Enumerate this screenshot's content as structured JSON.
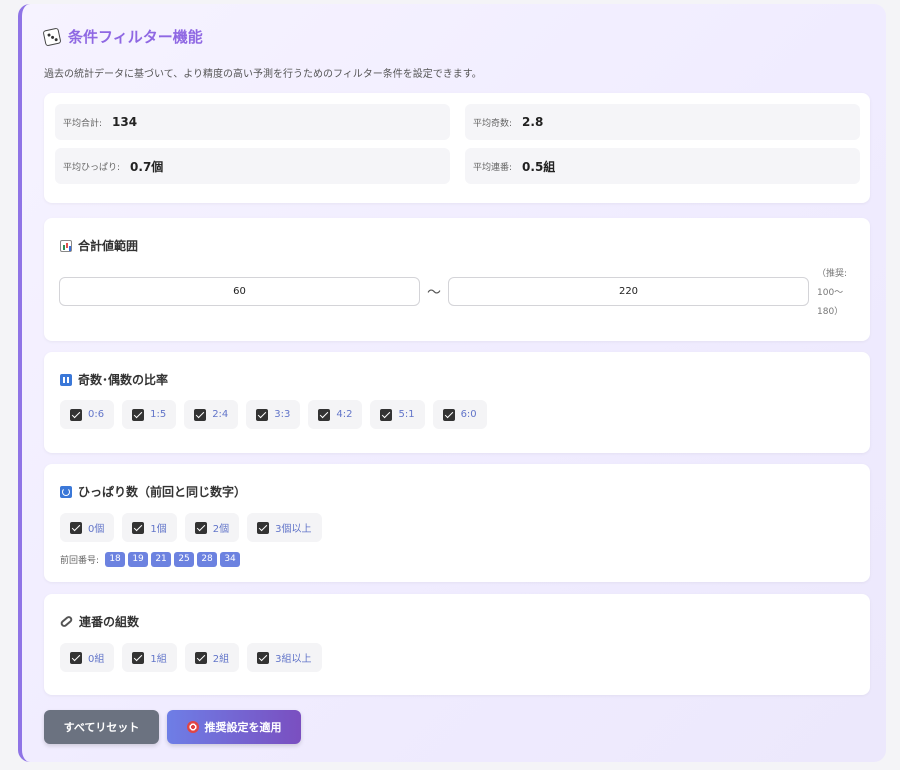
{
  "header": {
    "title": "条件フィルター機能",
    "description": "過去の統計データに基づいて、より精度の高い予測を行うためのフィルター条件を設定できます。",
    "icon": "dice-icon"
  },
  "stats": {
    "avg_sum_label": "平均合計:",
    "avg_sum_value": "134",
    "avg_odd_label": "平均奇数:",
    "avg_odd_value": "2.8",
    "avg_pull_label": "平均ひっぱり:",
    "avg_pull_value": "0.7個",
    "avg_consec_label": "平均連番:",
    "avg_consec_value": "0.5組"
  },
  "sum_range": {
    "title": "合計値範囲",
    "icon": "bar-chart-icon",
    "min_value": "60",
    "max_value": "220",
    "separator": "〜",
    "hint_line1": "（推奨:",
    "hint_line2": "100〜",
    "hint_line3": "180）"
  },
  "odd_even": {
    "title": "奇数･偶数の比率",
    "icon": "numbers-icon",
    "options": [
      "0:6",
      "1:5",
      "2:4",
      "3:3",
      "4:2",
      "5:1",
      "6:0"
    ]
  },
  "pull": {
    "title": "ひっぱり数（前回と同じ数字）",
    "icon": "cycle-icon",
    "options": [
      "0個",
      "1個",
      "2個",
      "3個以上"
    ],
    "prev_label": "前回番号:",
    "prev_numbers": [
      "18",
      "19",
      "21",
      "25",
      "28",
      "34"
    ]
  },
  "consecutive": {
    "title": "連番の組数",
    "icon": "link-icon",
    "options": [
      "0組",
      "1組",
      "2組",
      "3組以上"
    ]
  },
  "actions": {
    "reset_label": "すべてリセット",
    "apply_label": "推奨設定を適用",
    "apply_icon": "target-icon"
  },
  "colors": {
    "accent": "#8f68e3",
    "chip_text": "#6275c9",
    "prev_number_bg": "#6c82e0",
    "reset_bg": "#6b7280"
  }
}
